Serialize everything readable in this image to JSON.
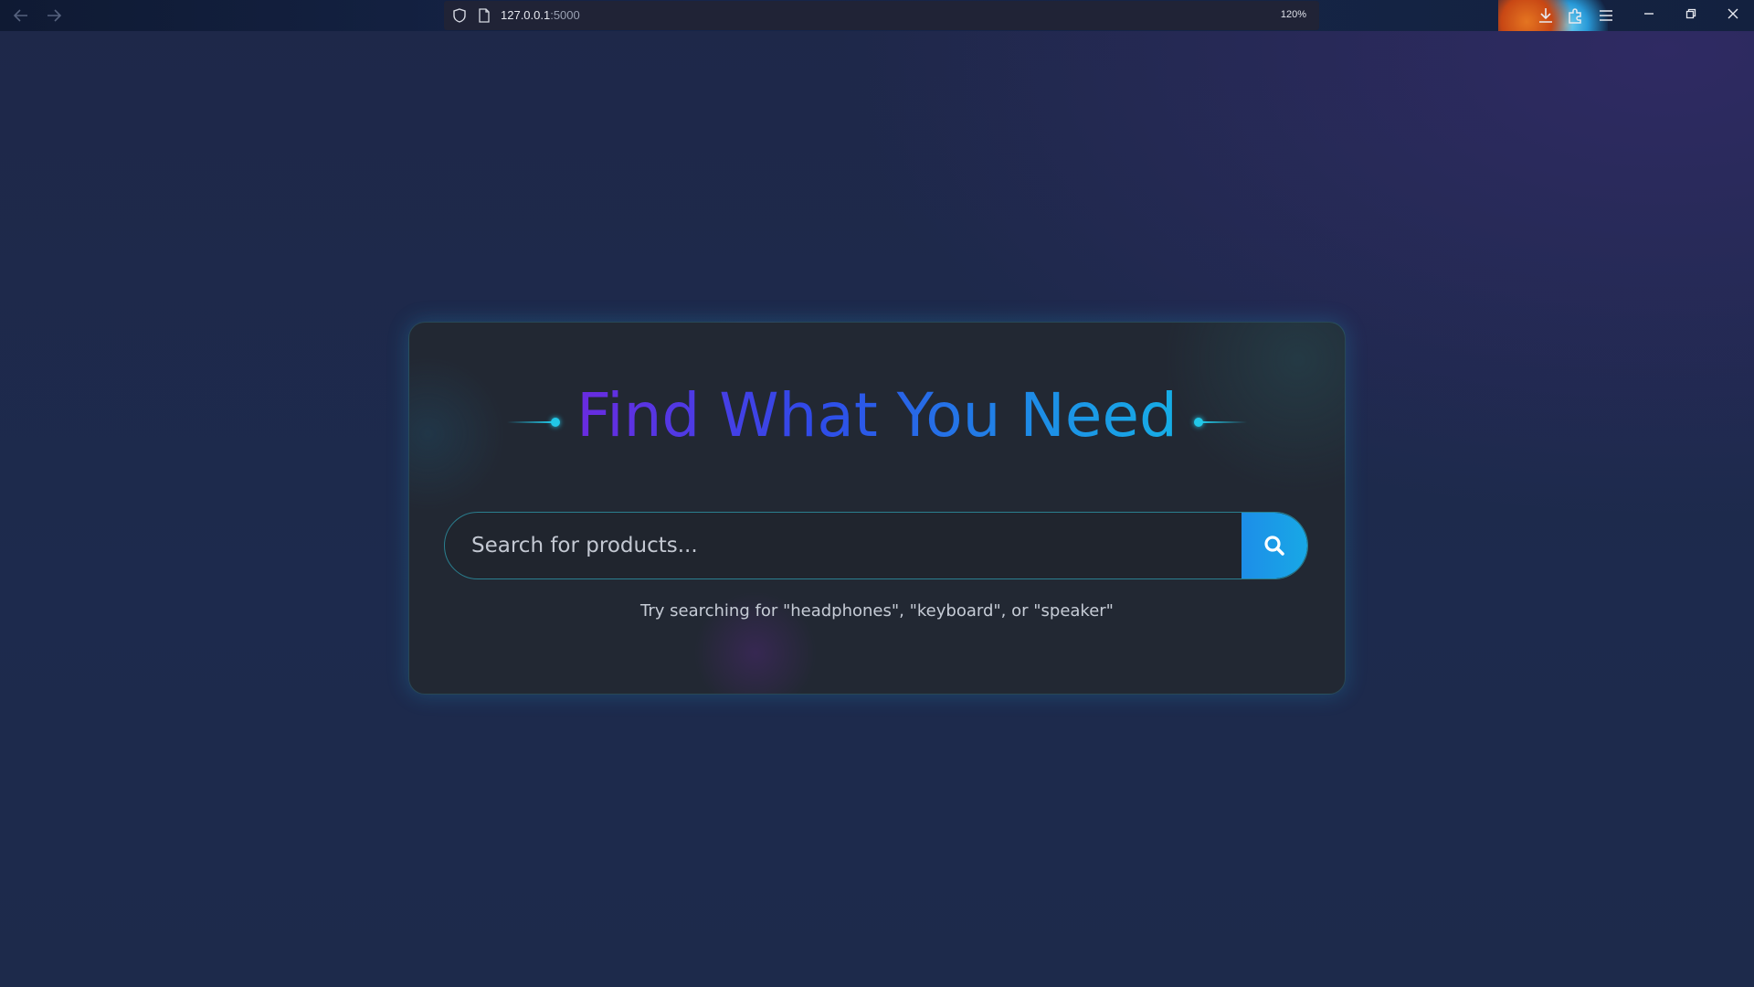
{
  "browser": {
    "url_host": "127.0.0.1",
    "url_port": ":5000",
    "zoom": "120%",
    "icons": {
      "back": "arrow-left-icon",
      "forward": "arrow-right-icon",
      "shield": "shield-icon",
      "page": "page-icon",
      "downloads": "download-icon",
      "extensions": "puzzle-icon",
      "menu": "hamburger-menu-icon",
      "minimize": "minimize-icon",
      "restore": "restore-icon",
      "close": "close-icon"
    }
  },
  "main": {
    "title": "Find What You Need",
    "search": {
      "placeholder": "Search for products...",
      "value": "",
      "button_icon": "search-icon"
    },
    "hint": "Try searching for \"headphones\", \"keyboard\", or \"speaker\""
  },
  "colors": {
    "background": "#1e2849",
    "card": "#222833",
    "accent_cyan": "#22c8e8",
    "title_gradient_start": "#6a2be0",
    "title_gradient_end": "#16aee6",
    "search_button": "#1d8ee8"
  }
}
